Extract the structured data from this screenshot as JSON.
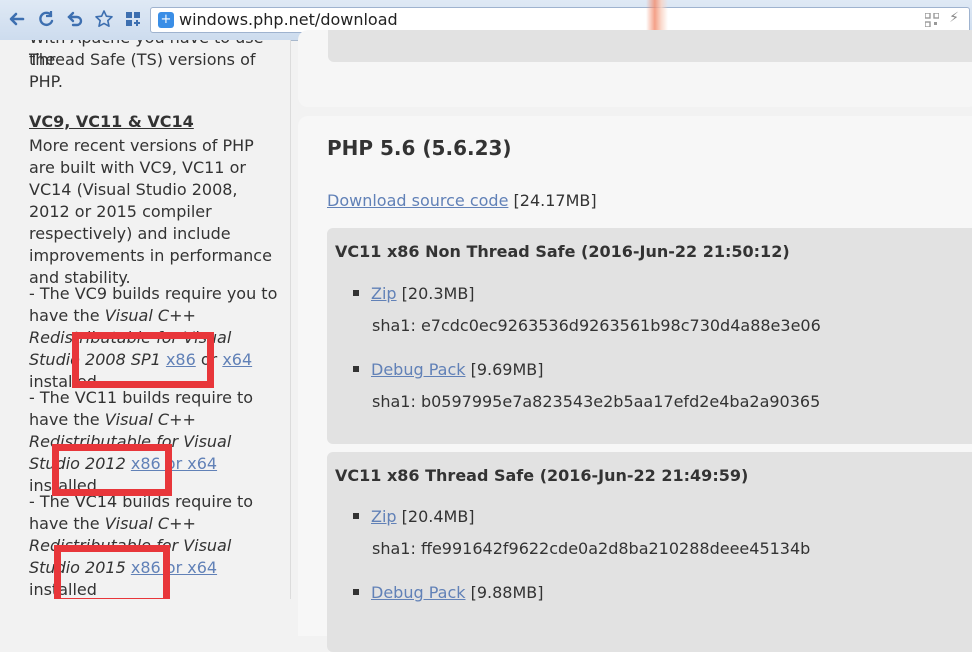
{
  "browser": {
    "url": "windows.php.net/download"
  },
  "sidebar": {
    "intro_fragment_1": "With Apache you have to use the",
    "intro_fragment_2": "Thread Safe (TS) versions of",
    "intro_fragment_3": "PHP.",
    "heading": "VC9, VC11 & VC14",
    "para1": "More recent versions of PHP are built with VC9, VC11 or VC14 (Visual Studio 2008, 2012 or 2015 compiler respectively) and include improvements in performance and stability.",
    "vc9": {
      "prefix": "- The VC9 builds require you to have the ",
      "italic": "Visual C++ Redistributable for Visual Studio 2008 SP1",
      "link1": "x86",
      "mid": " or ",
      "link2": "x64",
      "suffix": " installed"
    },
    "vc11": {
      "prefix": "- The VC11 builds require to have the ",
      "italic": "Visual C++ Redistributable for Visual Studio 2012",
      "link": "x86 or x64",
      "suffix": " installed"
    },
    "vc14": {
      "prefix": "- The VC14 builds require to have the ",
      "italic": "Visual C++ Redistributable for Visual Studio 2015",
      "link": "x86 or x64",
      "suffix": " installed"
    }
  },
  "main": {
    "release_title": "PHP 5.6 (5.6.23)",
    "source_link": "Download source code",
    "source_size": "[24.17MB]",
    "builds": [
      {
        "title": "VC11 x86 Non Thread Safe (2016-Jun-22 21:50:12)",
        "zip_label": "Zip",
        "zip_size": "[20.3MB]",
        "zip_sha": "sha1: e7cdc0ec9263536d9263561b98c730d4a88e3e06",
        "debug_label": "Debug Pack",
        "debug_size": "[9.69MB]",
        "debug_sha": "sha1: b0597995e7a823543e2b5aa17efd2e4ba2a90365"
      },
      {
        "title": "VC11 x86 Thread Safe (2016-Jun-22 21:49:59)",
        "zip_label": "Zip",
        "zip_size": "[20.4MB]",
        "zip_sha": "sha1: ffe991642f9622cde0a2d8ba210288deee45134b",
        "debug_label": "Debug Pack",
        "debug_size": "[9.88MB]"
      }
    ]
  },
  "colors": {
    "link": "#6181b7",
    "highlight": "#e8363a",
    "build_bg": "#e2e2e2"
  }
}
